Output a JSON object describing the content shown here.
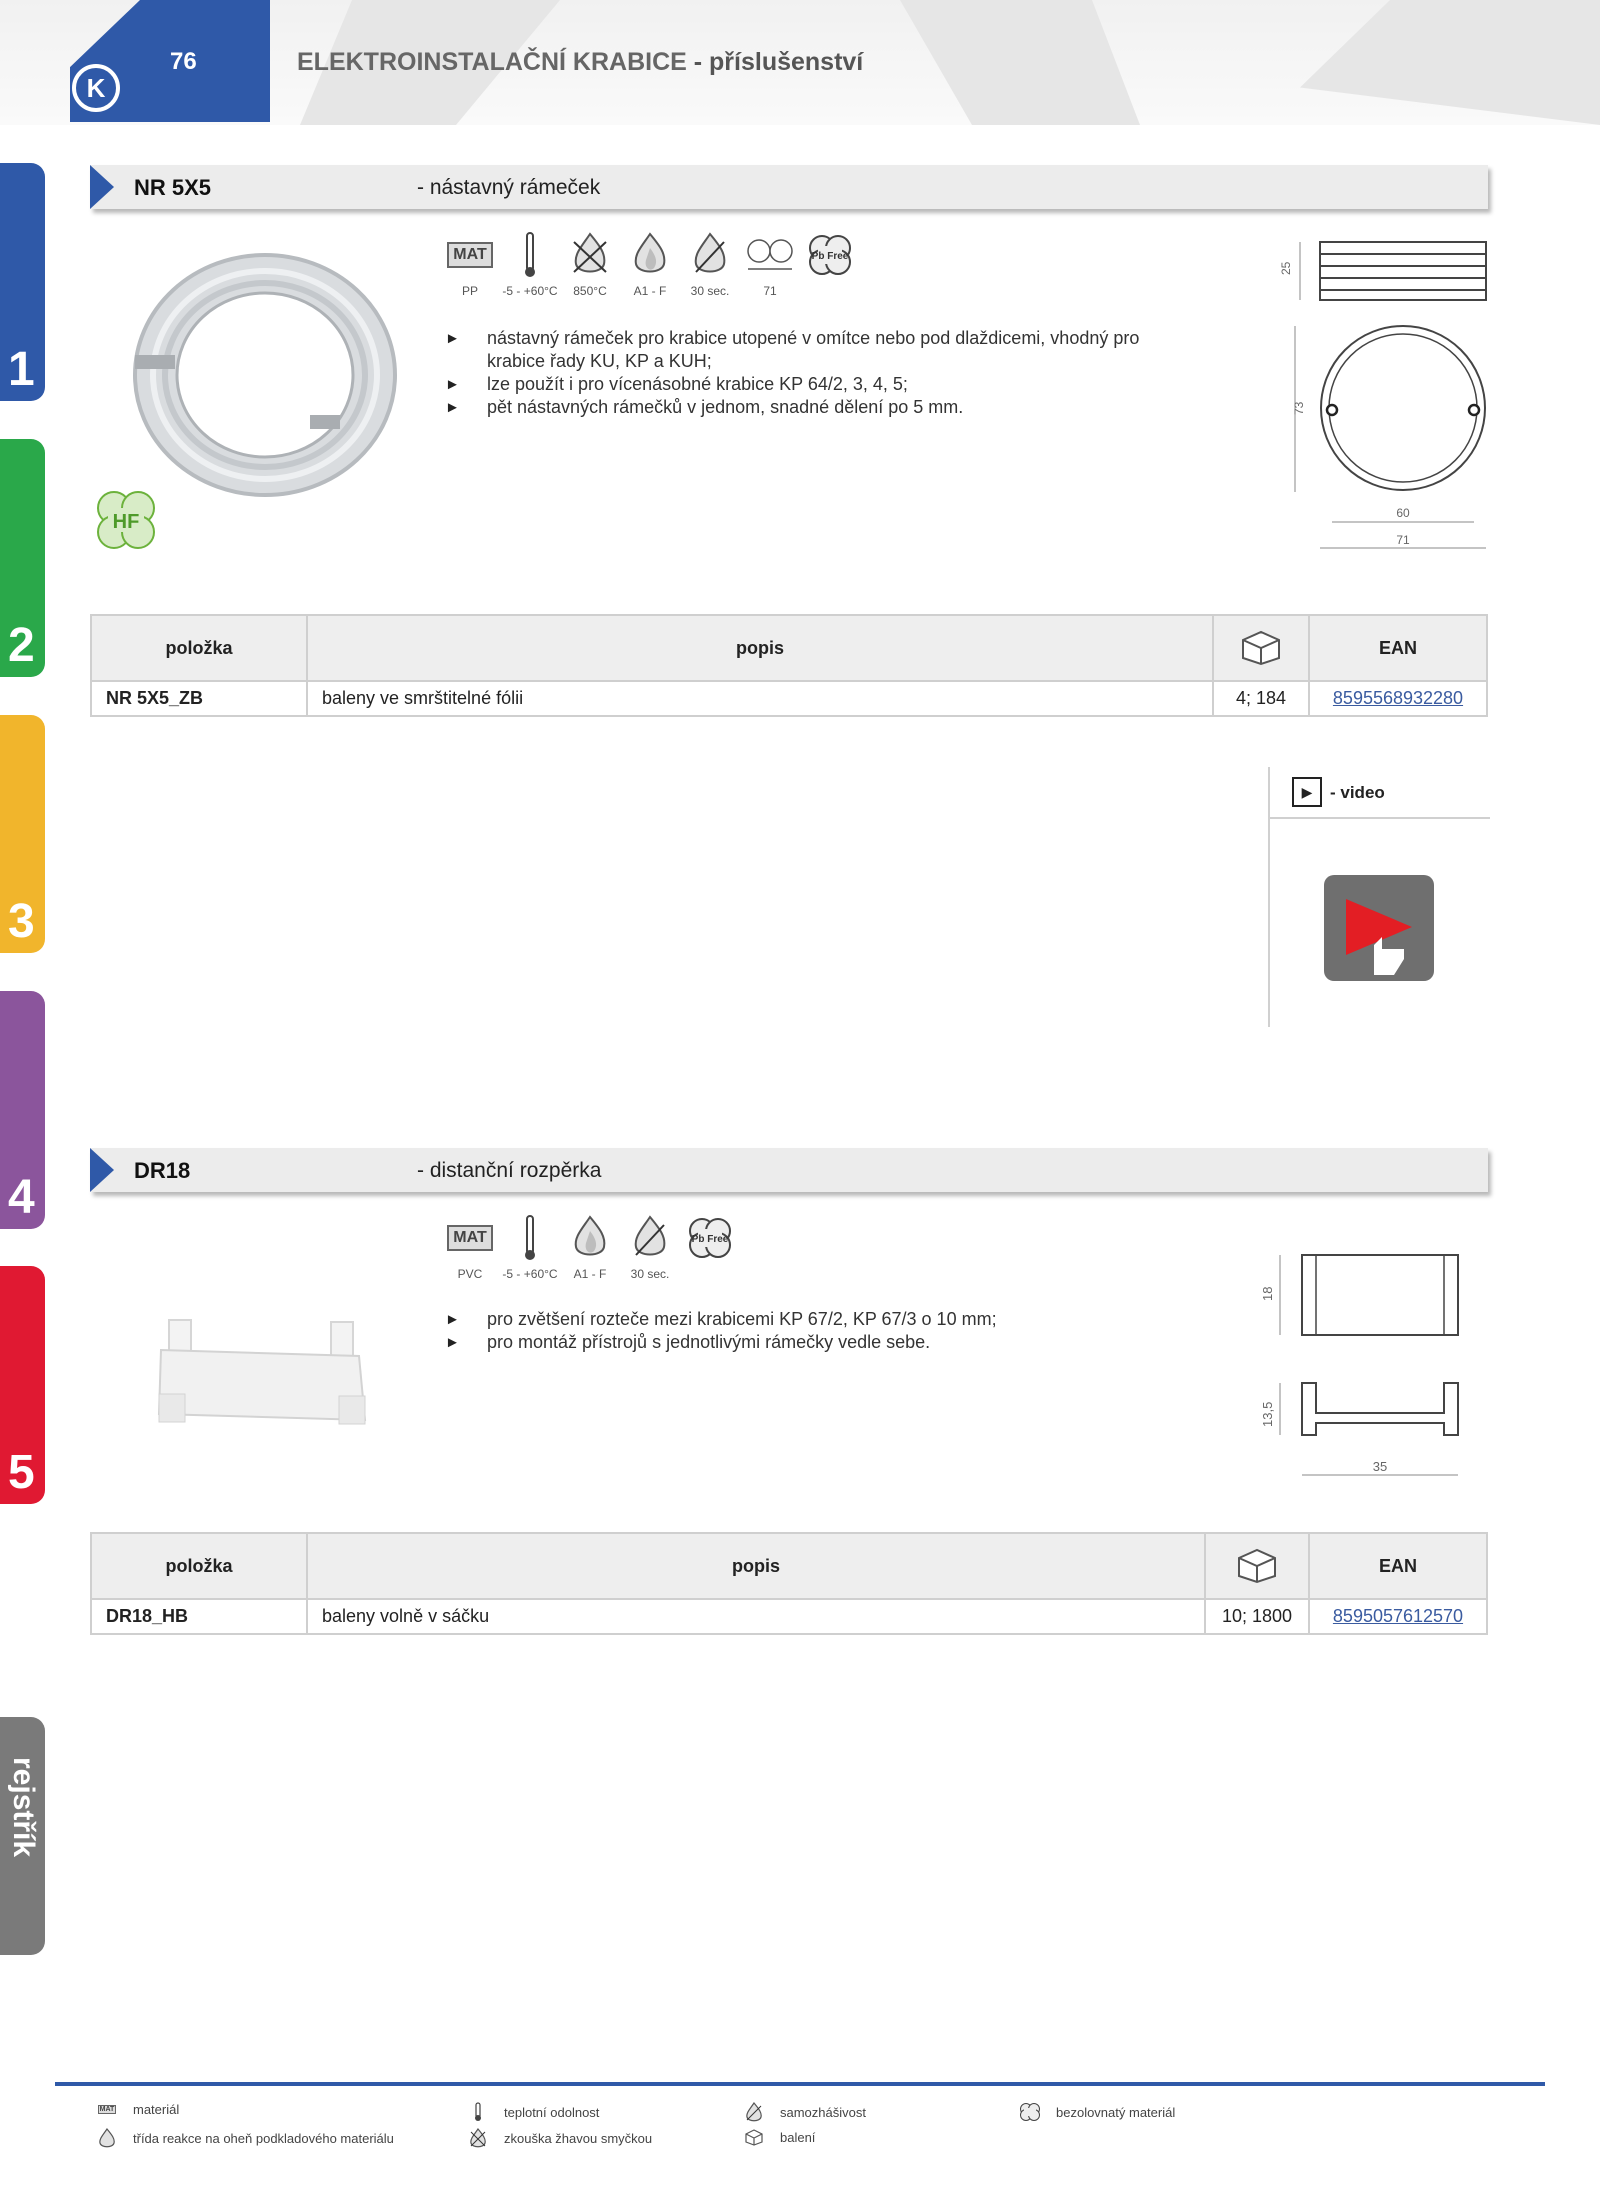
{
  "header": {
    "page_number": "76",
    "title": "ELEKTROINSTALAČNÍ KRABICE",
    "subtitle": " - příslušenství",
    "logo": "K"
  },
  "colors": {
    "brand_blue": "#2f59a8",
    "tab1": "#2f59a8",
    "tab2": "#2aa84a",
    "tab3": "#f1b52c",
    "tab4": "#8b559c",
    "tab5": "#e01932",
    "index": "#7a7a7a"
  },
  "side_tabs": [
    "1",
    "2",
    "3",
    "4",
    "5"
  ],
  "side_index_label": "rejstřík",
  "products": [
    {
      "code": "NR 5X5",
      "description": "- nástavný rámeček",
      "badge": "HF",
      "icons": [
        {
          "icon": "mat-icon",
          "label": "PP"
        },
        {
          "icon": "thermometer-icon",
          "label": "-5 - +60°C"
        },
        {
          "icon": "glow-wire-icon",
          "label": "850°C"
        },
        {
          "icon": "flame-icon",
          "label": "A1 - F"
        },
        {
          "icon": "self-extinguishing-icon",
          "label": "30 sec."
        },
        {
          "icon": "dimension-icon",
          "label": "71"
        },
        {
          "icon": "pb-free-icon",
          "label": ""
        }
      ],
      "bullets": [
        "nástavný rámeček pro krabice utopené v omítce nebo pod dlaždicemi, vhodný pro krabice řady KU, KP a KUH;",
        "lze použít i pro vícenásobné krabice KP 64/2, 3, 4, 5;",
        "pět nástavných rámečků v jednom, snadné dělení po 5 mm."
      ],
      "dims": {
        "height": "25",
        "outer": "73",
        "inner_width": "60",
        "outer_width": "71"
      },
      "table": {
        "headers": [
          "položka",
          "popis",
          "",
          "EAN"
        ],
        "rows": [
          [
            "NR 5X5_ZB",
            "baleny ve smrštitelné fólii",
            "4; 184",
            "8595568932280"
          ]
        ]
      }
    },
    {
      "code": "DR18",
      "description": "- distanční rozpěrka",
      "icons": [
        {
          "icon": "mat-icon",
          "label": "PVC"
        },
        {
          "icon": "thermometer-icon",
          "label": "-5 - +60°C"
        },
        {
          "icon": "flame-icon",
          "label": "A1 - F"
        },
        {
          "icon": "self-extinguishing-icon",
          "label": "30 sec."
        },
        {
          "icon": "pb-free-icon",
          "label": ""
        }
      ],
      "bullets": [
        "pro zvětšení rozteče mezi krabicemi KP 67/2, KP 67/3 o 10 mm;",
        "pro montáž přístrojů s jednotlivými rámečky vedle sebe."
      ],
      "dims": {
        "height": "18",
        "profile": "13,5",
        "width": "35"
      },
      "table": {
        "headers": [
          "položka",
          "popis",
          "",
          "EAN"
        ],
        "rows": [
          [
            "DR18_HB",
            "baleny volně v sáčku",
            "10; 1800",
            "8595057612570"
          ]
        ]
      }
    }
  ],
  "video": {
    "label": "- video",
    "play": "▶"
  },
  "mat_label": "MAT",
  "pb_label": "Pb Free",
  "legend": [
    {
      "icon": "mat-icon",
      "text": "materiál"
    },
    {
      "icon": "flame-icon",
      "text": "třída reakce na oheň podkladového materiálu"
    },
    {
      "icon": "thermometer-icon",
      "text": "teplotní odolnost"
    },
    {
      "icon": "glow-wire-icon",
      "text": "zkouška žhavou smyčkou"
    },
    {
      "icon": "self-extinguishing-icon",
      "text": "samozhášivost"
    },
    {
      "icon": "box-icon",
      "text": "balení"
    },
    {
      "icon": "pb-free-icon",
      "text": "bezolovnatý materiál"
    }
  ]
}
